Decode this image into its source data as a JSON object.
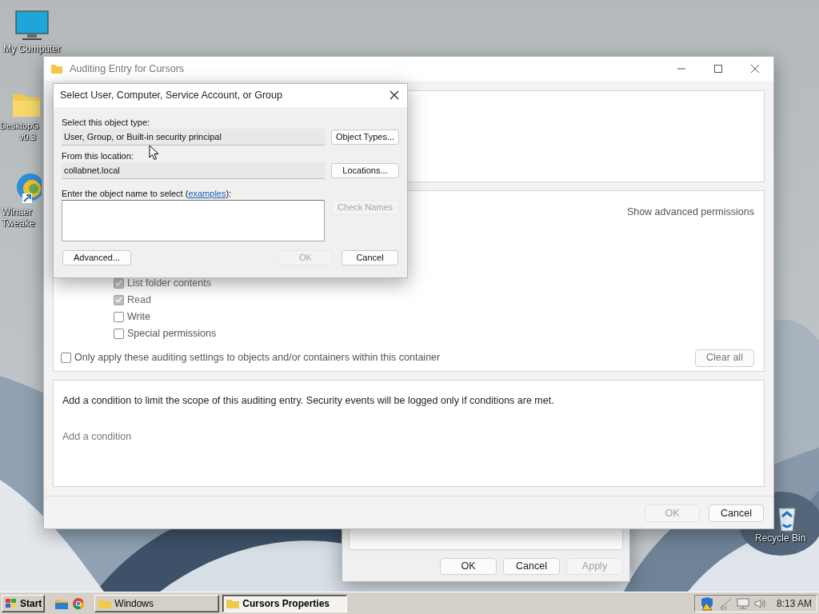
{
  "desktop_icons": [
    {
      "kind": "computer",
      "lines": [
        "My Computer"
      ]
    },
    {
      "kind": "folder",
      "lines": [
        "DesktopG",
        "v0.3"
      ]
    },
    {
      "kind": "swirl",
      "lines": [
        "Winaer",
        "Tweake"
      ]
    },
    {
      "kind": "recycle",
      "lines": [
        "Recycle Bin"
      ]
    }
  ],
  "back_window": {
    "buttons": [
      {
        "label": "OK",
        "disabled": false
      },
      {
        "label": "Cancel",
        "disabled": false
      },
      {
        "label": "Apply",
        "disabled": true
      }
    ]
  },
  "auditing_window": {
    "title": "Auditing Entry for Cursors",
    "show_advanced_link": "Show advanced permissions",
    "permissions": [
      {
        "label": "List folder contents",
        "checked": true,
        "disabled": true
      },
      {
        "label": "Read",
        "checked": true,
        "disabled": true
      },
      {
        "label": "Write",
        "checked": false,
        "disabled": false
      },
      {
        "label": "Special permissions",
        "checked": false,
        "disabled": false
      }
    ],
    "scope_option": {
      "label": "Only apply these auditing settings to objects and/or containers within this container",
      "checked": false
    },
    "clear_all_button": "Clear all",
    "condition_text": "Add a condition to limit the scope of this auditing entry. Security events will be logged only if conditions are met.",
    "add_condition_link": "Add a condition",
    "buttons": [
      {
        "label": "OK",
        "disabled": true
      },
      {
        "label": "Cancel",
        "disabled": false
      }
    ]
  },
  "select_dialog": {
    "title": "Select User, Computer, Service Account, or Group",
    "object_type_label": "Select this object type:",
    "object_type_value": "User, Group, or Built-in security principal",
    "object_types_button": "Object Types...",
    "location_label": "From this location:",
    "location_value": "collabnet.local",
    "locations_button": "Locations...",
    "name_label": "Enter the object name to select (",
    "name_link": "examples",
    "name_label_end": "):",
    "check_names_button": {
      "label": "Check Names",
      "disabled": true
    },
    "advanced_button": "Advanced...",
    "buttons": [
      {
        "label": "OK",
        "disabled": true
      },
      {
        "label": "Cancel",
        "disabled": false
      }
    ]
  },
  "taskbar": {
    "start": "Start",
    "tasks": [
      {
        "label": "Windows",
        "selected": false
      },
      {
        "label": "Cursors Properties",
        "selected": true
      }
    ],
    "clock": "8:13 AM"
  }
}
